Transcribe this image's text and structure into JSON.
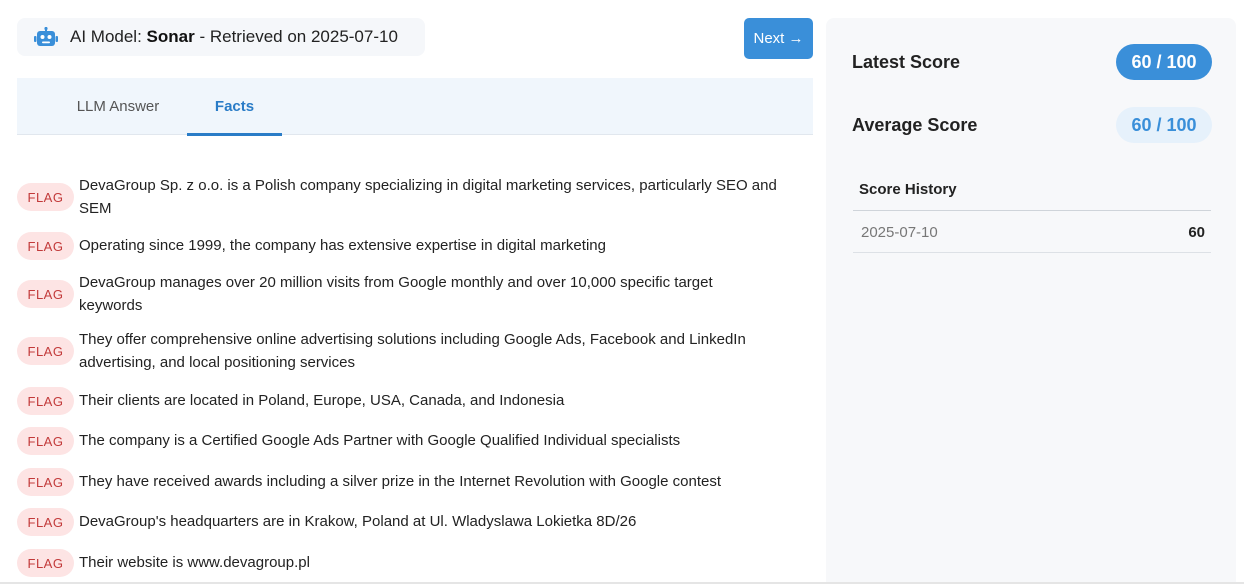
{
  "header": {
    "model_prefix": "AI Model: ",
    "model_name": "Sonar",
    "retrieved_text": " - Retrieved on 2025-07-10",
    "next_label": "Next →"
  },
  "tabs": [
    {
      "label": "LLM Answer",
      "active": false
    },
    {
      "label": "Facts",
      "active": true
    }
  ],
  "flag_label": "FLAG",
  "facts": [
    "DevaGroup Sp. z o.o. is a Polish company specializing in digital marketing services, particularly SEO and SEM",
    "Operating since 1999, the company has extensive expertise in digital marketing",
    "DevaGroup manages over 20 million visits from Google monthly and over 10,000 specific target keywords",
    "They offer comprehensive online advertising solutions including Google Ads, Facebook and LinkedIn advertising, and local positioning services",
    "Their clients are located in Poland, Europe, USA, Canada, and Indonesia",
    "The company is a Certified Google Ads Partner with Google Qualified Individual specialists",
    "They have received awards including a silver prize in the Internet Revolution with Google contest",
    "DevaGroup's headquarters are in Krakow, Poland at Ul. Wladyslawa Lokietka 8D/26",
    "Their website is www.devagroup.pl"
  ],
  "scores": {
    "latest_label": "Latest Score",
    "latest_value": "60 / 100",
    "average_label": "Average Score",
    "average_value": "60 / 100"
  },
  "history": {
    "title": "Score History",
    "rows": [
      {
        "date": "2025-07-10",
        "score": "60"
      }
    ]
  },
  "colors": {
    "accent": "#3a8fd9",
    "flag_bg": "#fde4e4",
    "flag_text": "#c23a3a"
  },
  "icons": {
    "model": "robot-icon"
  }
}
